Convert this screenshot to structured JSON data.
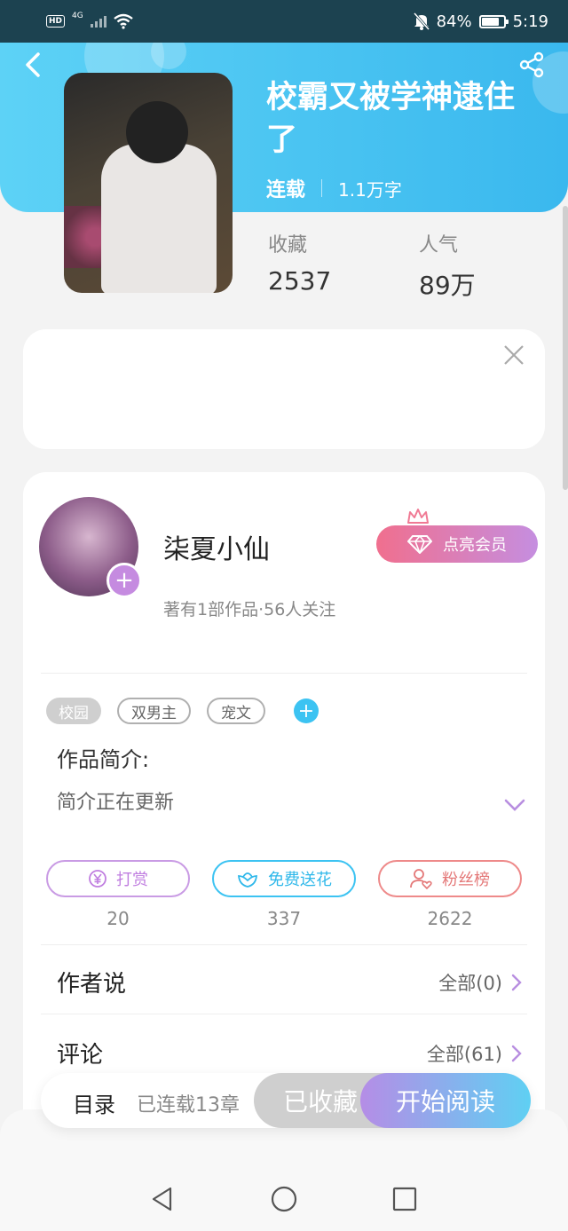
{
  "status_bar": {
    "hd": "HD",
    "network": "4G",
    "battery_percent": "84%",
    "battery_level": 0.84,
    "time": "5:19"
  },
  "book": {
    "title": "校霸又被学神逮住了",
    "status": "连载",
    "words": "1.1万字",
    "stats": [
      {
        "label": "收藏",
        "value": "2537"
      },
      {
        "label": "人气",
        "value": "89万"
      }
    ]
  },
  "author": {
    "name": "柒夏小仙",
    "sub": "著有1部作品·56人关注",
    "vip_label": "点亮会员"
  },
  "tags": [
    "校园",
    "双男主",
    "宠文"
  ],
  "intro": {
    "title": "作品简介:",
    "text": "简介正在更新"
  },
  "actions": [
    {
      "label": "打赏",
      "count": "20"
    },
    {
      "label": "免费送花",
      "count": "337"
    },
    {
      "label": "粉丝榜",
      "count": "2622"
    }
  ],
  "rows": {
    "author_says": {
      "title": "作者说",
      "right": "全部(0)"
    },
    "comments": {
      "title": "评论",
      "right": "全部(61)"
    }
  },
  "bottom_bar": {
    "toc": "目录",
    "toc_sub": "已连载13章",
    "favorited": "已收藏",
    "start_read": "开始阅读"
  },
  "colors": {
    "header": "#3ab8ee",
    "accent_purple": "#c58be0",
    "accent_blue": "#3cc3f2",
    "accent_red": "#ee8a8a"
  }
}
